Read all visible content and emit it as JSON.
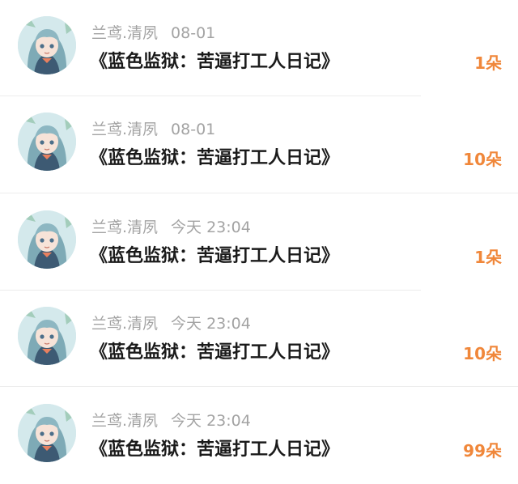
{
  "colors": {
    "count": "#f0873a",
    "meta": "#a3a3a3",
    "title": "#1a1a1a"
  },
  "items": [
    {
      "username": "兰鸢.清夙",
      "time": "08-01",
      "title": "《蓝色监狱：苦逼打工人日记》",
      "count": "1朵",
      "avatar_icon": "anime-avatar"
    },
    {
      "username": "兰鸢.清夙",
      "time": "08-01",
      "title": "《蓝色监狱：苦逼打工人日记》",
      "count": "10朵",
      "avatar_icon": "anime-avatar"
    },
    {
      "username": "兰鸢.清夙",
      "time": "今天 23:04",
      "title": "《蓝色监狱：苦逼打工人日记》",
      "count": "1朵",
      "avatar_icon": "anime-avatar"
    },
    {
      "username": "兰鸢.清夙",
      "time": "今天 23:04",
      "title": "《蓝色监狱：苦逼打工人日记》",
      "count": "10朵",
      "avatar_icon": "anime-avatar"
    },
    {
      "username": "兰鸢.清夙",
      "time": "今天 23:04",
      "title": "《蓝色监狱：苦逼打工人日记》",
      "count": "99朵",
      "avatar_icon": "anime-avatar"
    }
  ]
}
